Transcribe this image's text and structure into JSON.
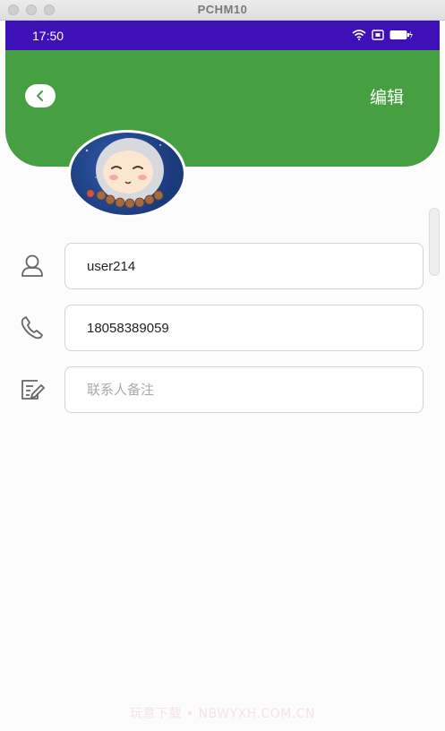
{
  "window": {
    "title": "PCHM10"
  },
  "statusbar": {
    "time": "17:50"
  },
  "header": {
    "edit_label": "编辑"
  },
  "form": {
    "name_value": "user214",
    "phone_value": "18058389059",
    "note_placeholder": "联系人备注"
  },
  "watermark": "玩意下载 • NBWYXH.COM.CN",
  "colors": {
    "statusbar": "#3d10b8",
    "header": "#46a041",
    "border": "#d3d3d3"
  },
  "icons": [
    "back-icon",
    "user-icon",
    "phone-icon",
    "note-edit-icon",
    "wifi-icon",
    "sim-icon",
    "battery-icon"
  ]
}
